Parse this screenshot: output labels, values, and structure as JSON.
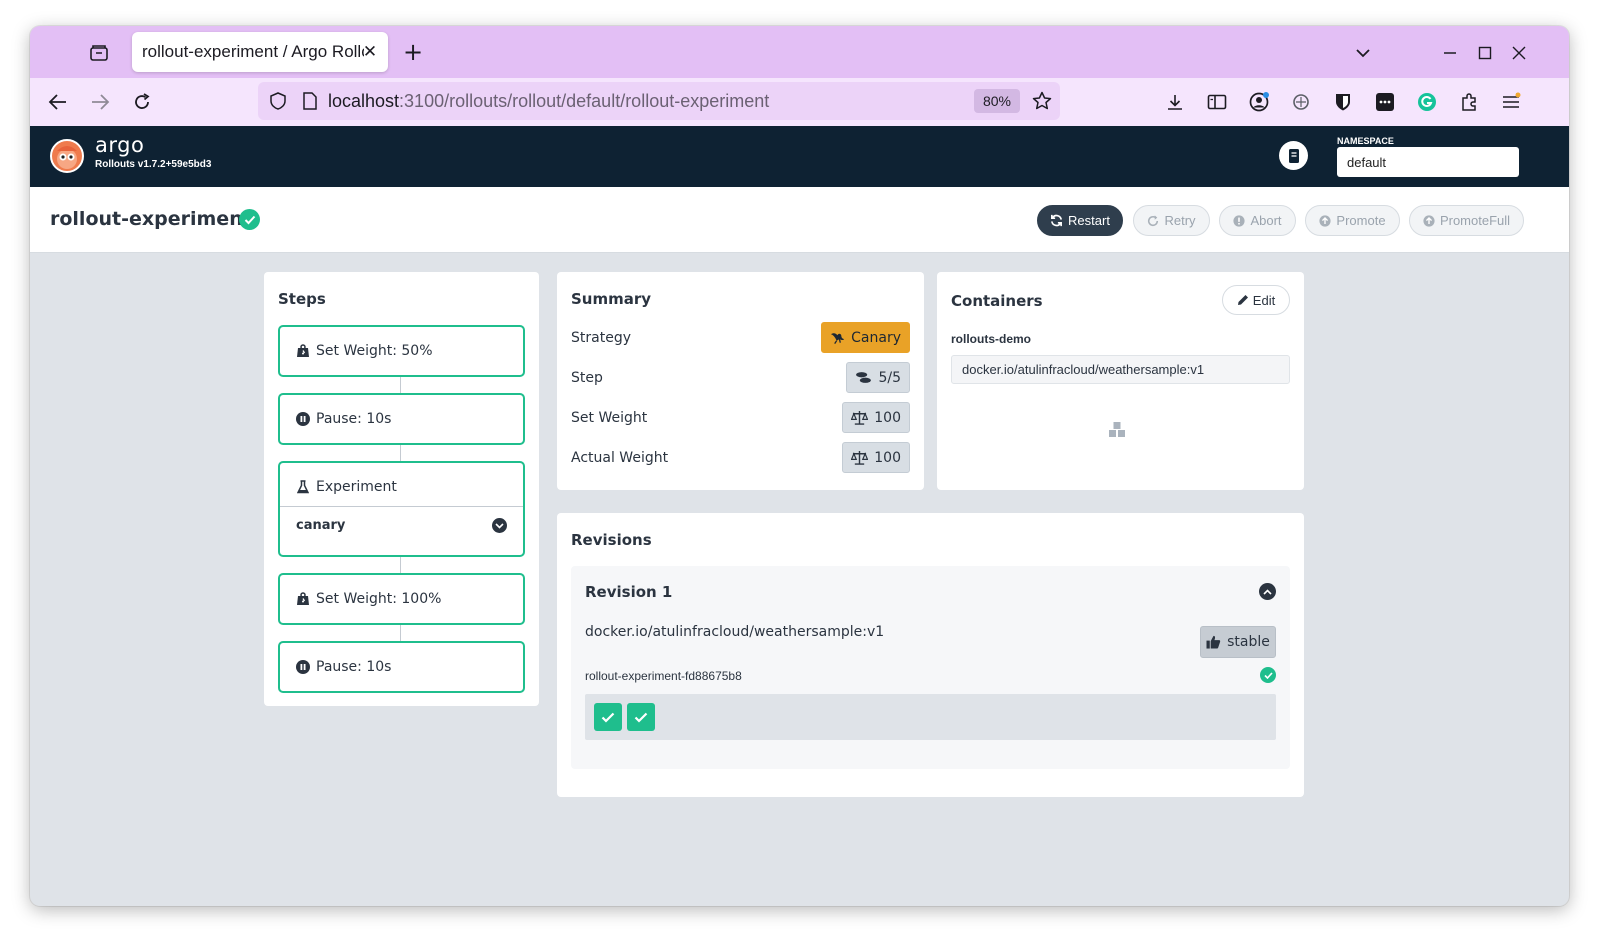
{
  "browser": {
    "tab_title": "rollout-experiment / Argo Rollouts",
    "url_host": "localhost",
    "url_path": ":3100/rollouts/rollout/default/rollout-experiment",
    "zoom": "80%"
  },
  "header": {
    "brand": "argo",
    "version": "Rollouts v1.7.2+59e5bd3",
    "namespace_label": "NAMESPACE",
    "namespace_value": "default"
  },
  "rollout": {
    "name": "rollout-experiment",
    "actions": [
      "Restart",
      "Retry",
      "Abort",
      "Promote",
      "PromoteFull"
    ]
  },
  "steps": {
    "title": "Steps",
    "items": [
      {
        "icon": "weight-icon",
        "label": "Set Weight: 50%"
      },
      {
        "icon": "pause-icon",
        "label": "Pause: 10s"
      },
      {
        "icon": "flask-icon",
        "label": "Experiment",
        "sub_label": "canary"
      },
      {
        "icon": "weight-icon",
        "label": "Set Weight: 100%"
      },
      {
        "icon": "pause-icon",
        "label": "Pause: 10s"
      }
    ]
  },
  "summary": {
    "title": "Summary",
    "rows": [
      {
        "label": "Strategy",
        "value": "Canary",
        "icon": "dove-icon"
      },
      {
        "label": "Step",
        "value": "5/5",
        "icon": "shoe-prints-icon"
      },
      {
        "label": "Set Weight",
        "value": "100",
        "icon": "balance-scale-icon"
      },
      {
        "label": "Actual Weight",
        "value": "100",
        "icon": "balance-scale-icon"
      }
    ]
  },
  "containers": {
    "title": "Containers",
    "edit_label": "Edit",
    "name": "rollouts-demo",
    "image": "docker.io/atulinfracloud/weathersample:v1"
  },
  "revisions": {
    "title": "Revisions",
    "items": [
      {
        "title": "Revision 1",
        "image": "docker.io/atulinfracloud/weathersample:v1",
        "badge": "stable",
        "replicaset": "rollout-experiment-fd88675b8",
        "pods": [
          "ready",
          "ready"
        ]
      }
    ]
  },
  "colors": {
    "accent_green": "#1fbe8d",
    "canary_orange": "#e9a227",
    "header_navy": "#0e2233",
    "tabbar_purple": "#e3bff5"
  }
}
